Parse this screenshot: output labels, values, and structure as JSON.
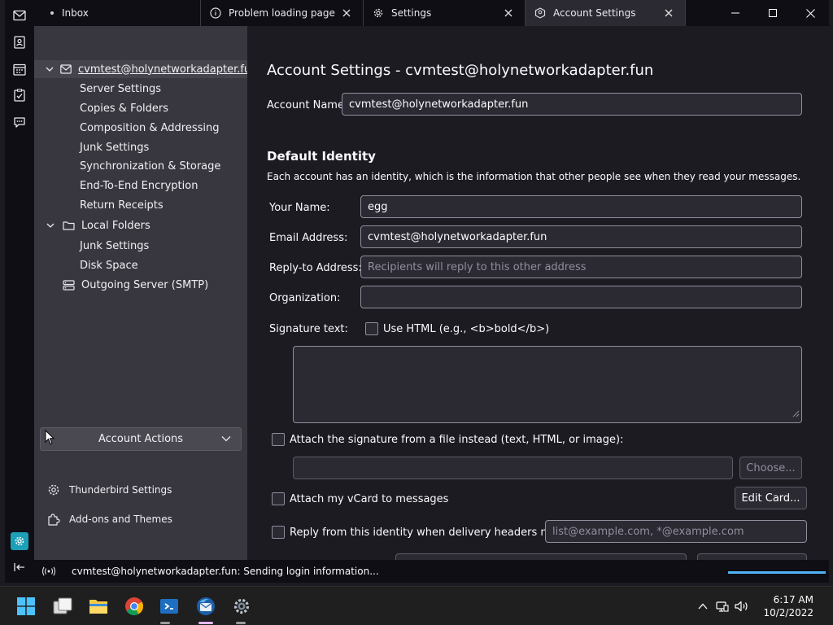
{
  "tabs": [
    {
      "label": "Inbox"
    },
    {
      "label": "Problem loading page"
    },
    {
      "label": "Settings"
    },
    {
      "label": "Account Settings"
    }
  ],
  "tree": {
    "account_email": "cvmtest@holynetworkadapter.fun",
    "account_subitems": [
      "Server Settings",
      "Copies & Folders",
      "Composition & Addressing",
      "Junk Settings",
      "Synchronization & Storage",
      "End-To-End Encryption",
      "Return Receipts"
    ],
    "local_folders": "Local Folders",
    "local_subitems": [
      "Junk Settings",
      "Disk Space"
    ],
    "outgoing_server": "Outgoing Server (SMTP)",
    "account_actions": "Account Actions",
    "thunderbird_settings": "Thunderbird Settings",
    "addons_themes": "Add-ons and Themes"
  },
  "main": {
    "title": "Account Settings - cvmtest@holynetworkadapter.fun",
    "account_name_label": "Account Name:",
    "account_name_value": "cvmtest@holynetworkadapter.fun",
    "default_identity_title": "Default Identity",
    "default_identity_desc": "Each account has an identity, which is the information that other people see when they read your messages.",
    "your_name_label": "Your Name:",
    "your_name_value": "egg",
    "email_label": "Email Address:",
    "email_value": "cvmtest@holynetworkadapter.fun",
    "reply_to_label": "Reply-to Address:",
    "reply_to_placeholder": "Recipients will reply to this other address",
    "organization_label": "Organization:",
    "organization_value": "",
    "signature_label": "Signature text:",
    "use_html_label": "Use HTML (e.g., <b>bold</b>)",
    "attach_sig_label": "Attach the signature from a file instead (text, HTML, or image):",
    "choose_button": "Choose...",
    "attach_vcard_label": "Attach my vCard to messages",
    "edit_card_button": "Edit Card...",
    "reply_identity_label": "Reply from this identity when delivery headers match:",
    "reply_identity_placeholder": "list@example.com, *@example.com"
  },
  "status": {
    "text": "cvmtest@holynetworkadapter.fun: Sending login information...",
    "progress_percent": 100
  },
  "taskbar": {
    "time": "6:17 AM",
    "date": "10/2/2022"
  },
  "colors": {
    "accent": "#4fb3f6",
    "panel_bg": "#38373f",
    "content_bg": "#1c1b22",
    "tabbar_bg": "#0f0e14"
  }
}
